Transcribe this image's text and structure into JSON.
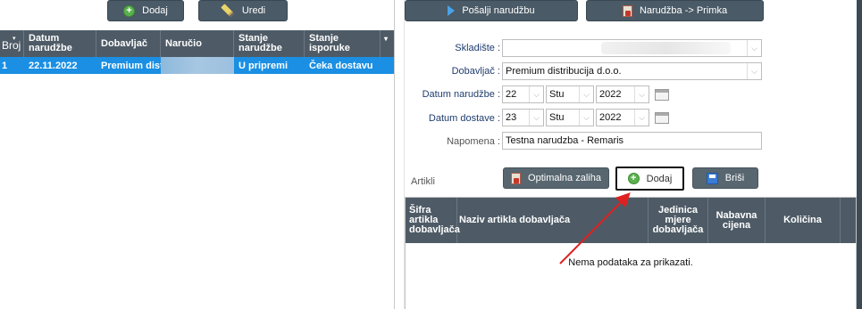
{
  "toolbar_left": {
    "add_label": "Dodaj",
    "edit_label": "Uredi"
  },
  "toolbar_right": {
    "send_label": "Pošalji narudžbu",
    "convert_label": "Narudžba -> Primka"
  },
  "orders_grid": {
    "columns": [
      "Broj",
      "Datum narudžbe",
      "Dobavljač",
      "Naručio",
      "Stanje narudžbe",
      "Stanje isporuke"
    ],
    "col_date_l1": "Datum",
    "col_date_l2": "narudžbe",
    "col_state_l1": "Stanje",
    "col_state_l2": "narudžbe",
    "col_delivery_l1": "Stanje",
    "col_delivery_l2": "isporuke",
    "rows": [
      {
        "broj": "1",
        "datum": "22.11.2022",
        "dobavljac": "Premium dist...",
        "narucio": "",
        "stanje_narudzbe": "U pripremi",
        "stanje_isporuke": "Čeka dostavu"
      }
    ],
    "header_color": "#4e5b66",
    "selected_row_color": "#1a8fe3"
  },
  "form": {
    "warehouse_label": "Skladište :",
    "warehouse_value": "",
    "supplier_label": "Dobavljač :",
    "supplier_value": "Premium distribucija d.o.o.",
    "order_date_label": "Datum narudžbe :",
    "order_date": {
      "day": "22",
      "month": "Stu",
      "year": "2022"
    },
    "delivery_date_label": "Datum dostave :",
    "delivery_date": {
      "day": "23",
      "month": "Stu",
      "year": "2022"
    },
    "note_label": "Napomena :",
    "note_value": "Testna narudzba - Remaris"
  },
  "articles": {
    "section_label": "Artikli",
    "optimal_label": "Optimalna zaliha",
    "add_label": "Dodaj",
    "delete_label": "Briši",
    "col_code_l1": "Šifra",
    "col_code_l2": "artikla",
    "col_code_l3": "dobavljača",
    "col_name": "Naziv artikla dobavljača",
    "col_unit_l1": "Jedinica",
    "col_unit_l2": "mjere",
    "col_unit_l3": "dobavljača",
    "col_price_l1": "Nabavna",
    "col_price_l2": "cijena",
    "col_qty": "Količina",
    "empty_message": "Nema podataka za prikazati."
  },
  "annotation": {
    "arrow_color": "#e02020"
  }
}
